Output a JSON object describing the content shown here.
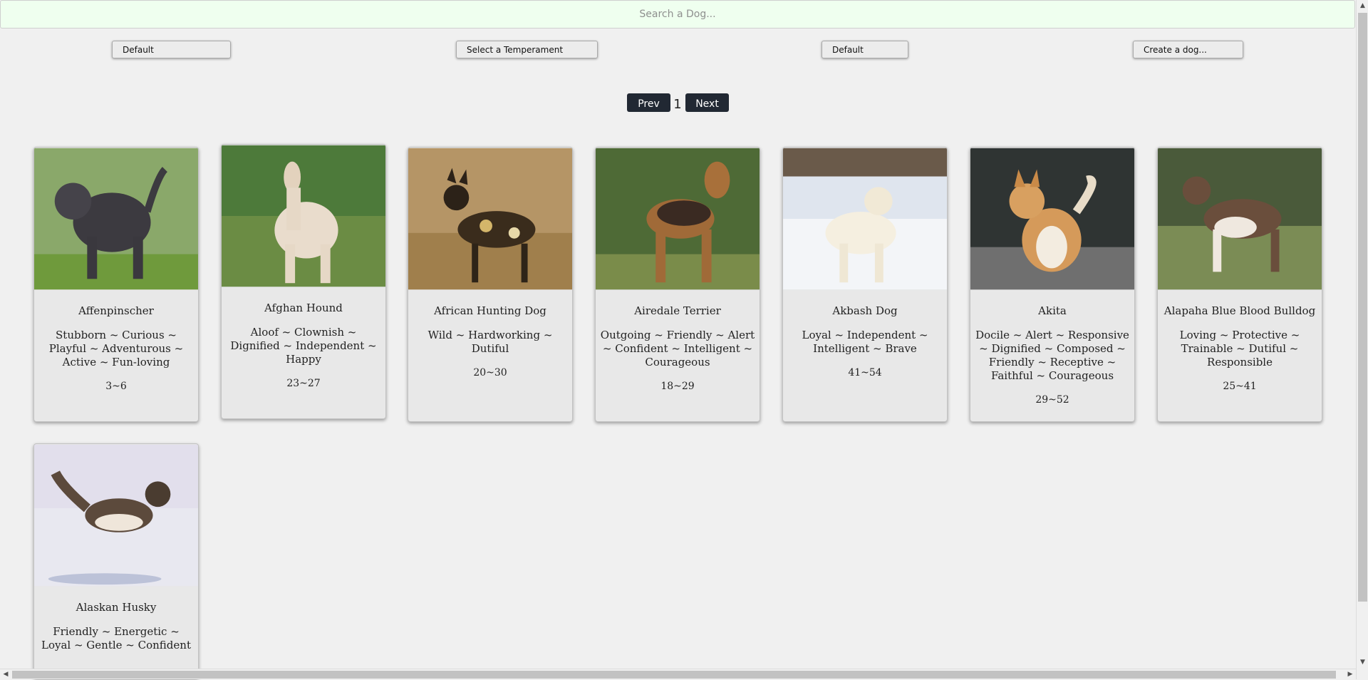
{
  "search": {
    "placeholder": "Search a Dog..."
  },
  "controls": {
    "sort_default_1": "Default",
    "temperament_select": "Select a Temperament",
    "sort_default_2": "Default",
    "create_dog": "Create a dog..."
  },
  "pagination": {
    "prev_label": "Prev",
    "current_page": "1",
    "next_label": "Next"
  },
  "dogs": [
    {
      "name": "Affenpinscher",
      "temperament": "Stubborn ~ Curious ~ Playful ~ Adventurous ~ Active ~ Fun-loving",
      "weight": "3~6"
    },
    {
      "name": "Afghan Hound",
      "temperament": "Aloof ~ Clownish ~ Dignified ~ Independent ~ Happy",
      "weight": "23~27"
    },
    {
      "name": "African Hunting Dog",
      "temperament": "Wild ~ Hardworking ~ Dutiful",
      "weight": "20~30"
    },
    {
      "name": "Airedale Terrier",
      "temperament": "Outgoing ~ Friendly ~ Alert ~ Confident ~ Intelligent ~ Courageous",
      "weight": "18~29"
    },
    {
      "name": "Akbash Dog",
      "temperament": "Loyal ~ Independent ~ Intelligent ~ Brave",
      "weight": "41~54"
    },
    {
      "name": "Akita",
      "temperament": "Docile ~ Alert ~ Responsive ~ Dignified ~ Composed ~ Friendly ~ Receptive ~ Faithful ~ Courageous",
      "weight": "29~52"
    },
    {
      "name": "Alapaha Blue Blood Bulldog",
      "temperament": "Loving ~ Protective ~ Trainable ~ Dutiful ~ Responsible",
      "weight": "25~41"
    },
    {
      "name": "Alaskan Husky",
      "temperament": "Friendly ~ Energetic ~ Loyal ~ Gentle ~ Confident",
      "weight": ""
    }
  ]
}
